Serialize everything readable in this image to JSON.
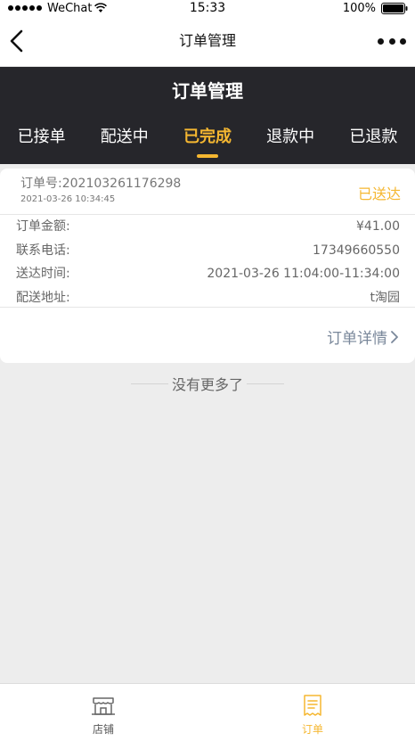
{
  "status_bar": {
    "carrier": "WeChat",
    "time": "15:33",
    "battery": "100%"
  },
  "nav": {
    "title": "订单管理",
    "back_icon": "chevron-left-icon",
    "more_icon": "more-dots-icon"
  },
  "header": {
    "title": "订单管理",
    "tabs": [
      {
        "label": "已接单",
        "active": false
      },
      {
        "label": "配送中",
        "active": false
      },
      {
        "label": "已完成",
        "active": true
      },
      {
        "label": "退款中",
        "active": false
      },
      {
        "label": "已退款",
        "active": false
      }
    ]
  },
  "order": {
    "number": "订单号:202103261176298",
    "time": "2021-03-26 10:34:45",
    "status": "已送达",
    "fields": [
      {
        "label": "订单金额:",
        "value": "¥41.00"
      },
      {
        "label": "联系电话:",
        "value": "17349660550"
      },
      {
        "label": "送达时间:",
        "value": "2021-03-26 11:04:00-11:34:00"
      },
      {
        "label": "配送地址:",
        "value": "t淘园"
      }
    ],
    "detail_link": "订单详情"
  },
  "list_end": "没有更多了",
  "tab_bar": {
    "items": [
      {
        "label": "店铺",
        "icon": "store-icon",
        "active": false
      },
      {
        "label": "订单",
        "icon": "receipt-icon",
        "active": true
      }
    ]
  },
  "colors": {
    "accent": "#f5b731",
    "header_bg": "#26262b",
    "page_bg": "#ededed",
    "link": "#7a889b"
  }
}
